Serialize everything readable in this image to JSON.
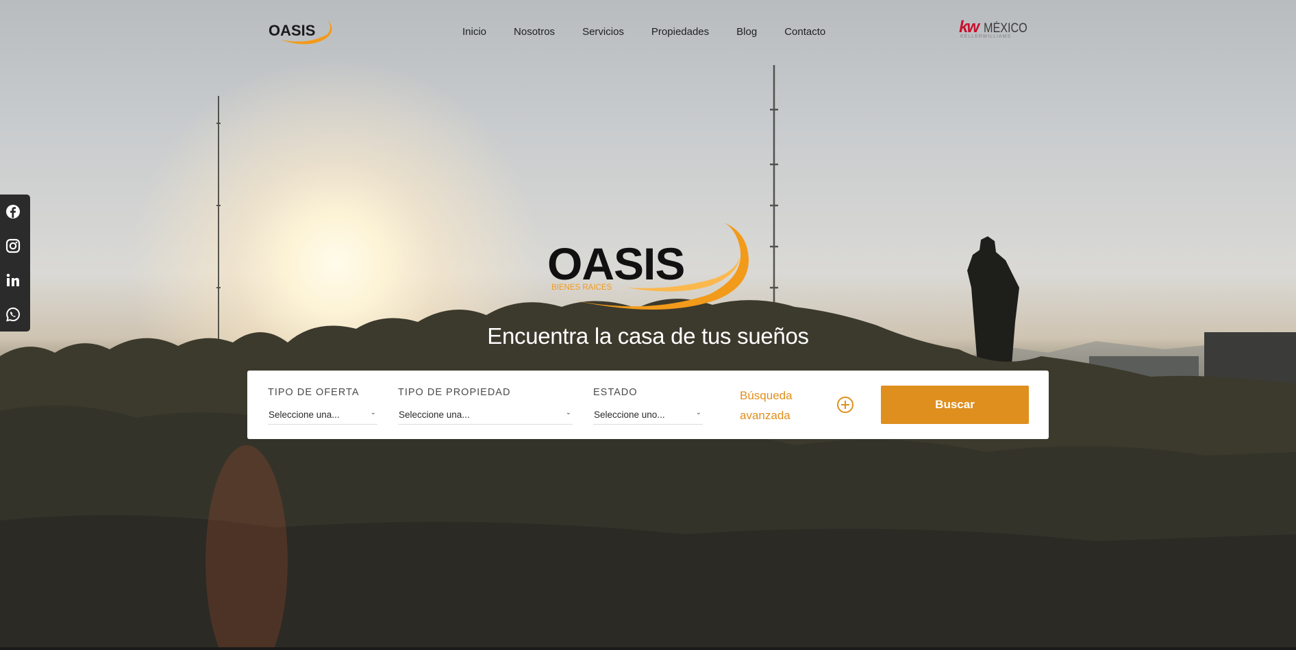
{
  "brand": {
    "name": "OASIS",
    "sub": "BIENES RAICES",
    "primary_color": "#de8f1e"
  },
  "nav": {
    "items": [
      "Inicio",
      "Nosotros",
      "Servicios",
      "Propiedades",
      "Blog",
      "Contacto"
    ]
  },
  "partner": {
    "kw": "kw",
    "country": "MÉXICO",
    "sub": "KELLERWILLIAMS"
  },
  "social": {
    "icons": [
      "facebook-icon",
      "instagram-icon",
      "linkedin-icon",
      "whatsapp-icon"
    ]
  },
  "hero": {
    "tagline": "Encuentra la casa de tus sueños"
  },
  "search": {
    "offer_label": "TIPO DE OFERTA",
    "offer_value": "Seleccione una...",
    "property_label": "TIPO DE PROPIEDAD",
    "property_value": "Seleccione una...",
    "state_label": "ESTADO",
    "state_value": "Seleccione uno...",
    "advanced_label": "Búsqueda avanzada",
    "button_label": "Buscar"
  }
}
